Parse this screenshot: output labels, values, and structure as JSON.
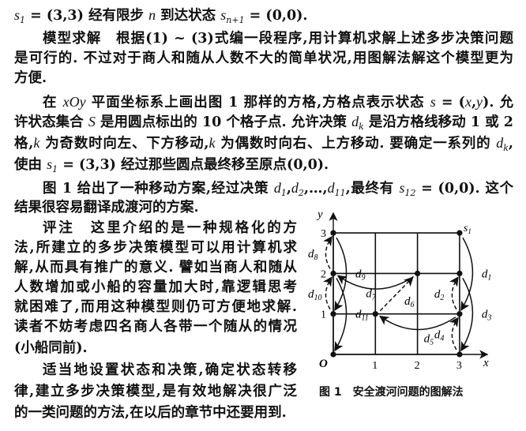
{
  "text": {
    "lines": [
      {
        "full": false,
        "indent": false,
        "segs": [
          [
            "m",
            "s"
          ],
          [
            "s",
            "1"
          ],
          [
            "t",
            " = (3,3) 经有限步 "
          ],
          [
            "m",
            "n"
          ],
          [
            "t",
            " 到达状态 "
          ],
          [
            "m",
            "s"
          ],
          [
            "s",
            "n+1"
          ],
          [
            "t",
            " = (0,0)."
          ]
        ]
      },
      {
        "full": true,
        "indent": true,
        "segs": [
          [
            "b",
            "模型求解"
          ],
          [
            "t",
            "　根据(1) ~ (3)式编一段程序,用计算机求解上述多步决策问题"
          ]
        ]
      },
      {
        "full": true,
        "indent": false,
        "segs": [
          [
            "t",
            "是可行的. 不过对于商人和随从人数不大的简单状况,用图解法解这个模型更为"
          ]
        ]
      },
      {
        "full": false,
        "indent": false,
        "segs": [
          [
            "t",
            "方便."
          ]
        ]
      },
      {
        "full": true,
        "indent": true,
        "segs": [
          [
            "t",
            "在 "
          ],
          [
            "m",
            "xOy"
          ],
          [
            "t",
            " 平面坐标系上画出图 1 那样的方格,方格点表示状态 "
          ],
          [
            "m",
            "s"
          ],
          [
            "t",
            " = ("
          ],
          [
            "m",
            "x"
          ],
          [
            "t",
            ","
          ],
          [
            "m",
            "y"
          ],
          [
            "t",
            "). 允"
          ]
        ]
      },
      {
        "full": true,
        "indent": false,
        "segs": [
          [
            "t",
            "许状态集合 "
          ],
          [
            "m",
            "S"
          ],
          [
            "t",
            " 是用圆点标出的 10 个格子点. 允许决策 "
          ],
          [
            "m",
            "d"
          ],
          [
            "s",
            "k"
          ],
          [
            "t",
            " 是沿方格线移动 1 或 2"
          ]
        ]
      },
      {
        "full": true,
        "indent": false,
        "segs": [
          [
            "t",
            "格,"
          ],
          [
            "m",
            "k"
          ],
          [
            "t",
            " 为奇数时向左、下方移动,"
          ],
          [
            "m",
            "k"
          ],
          [
            "t",
            " 为偶数时向右、上方移动. 要确定一系列的 "
          ],
          [
            "m",
            "d"
          ],
          [
            "s",
            "k"
          ],
          [
            "t",
            ","
          ]
        ]
      },
      {
        "full": false,
        "indent": false,
        "segs": [
          [
            "t",
            "使由 "
          ],
          [
            "m",
            "s"
          ],
          [
            "s",
            "1"
          ],
          [
            "t",
            " = (3,3) 经过那些圆点最终移至原点(0,0)."
          ]
        ]
      },
      {
        "full": true,
        "indent": true,
        "segs": [
          [
            "t",
            "图 1 给出了一种移动方案,经过决策 "
          ],
          [
            "m",
            "d"
          ],
          [
            "s",
            "1"
          ],
          [
            "t",
            ","
          ],
          [
            "m",
            "d"
          ],
          [
            "s",
            "2"
          ],
          [
            "t",
            ",…,"
          ],
          [
            "m",
            "d"
          ],
          [
            "s",
            "11"
          ],
          [
            "t",
            ",最终有 "
          ],
          [
            "m",
            "s"
          ],
          [
            "s",
            "12"
          ],
          [
            "t",
            " = (0,0). 这个"
          ]
        ]
      },
      {
        "full": false,
        "indent": false,
        "segs": [
          [
            "t",
            "结果很容易翻译成渡河的方案."
          ]
        ]
      },
      {
        "full": true,
        "indent": true,
        "narrow": true,
        "segs": [
          [
            "b",
            "评注"
          ],
          [
            "t",
            "　这里介绍的是一种规格化的方"
          ]
        ]
      },
      {
        "full": true,
        "indent": false,
        "narrow": true,
        "segs": [
          [
            "t",
            "法,所建立的多步决策模型可以用计算机求"
          ]
        ]
      },
      {
        "full": true,
        "indent": false,
        "narrow": true,
        "segs": [
          [
            "t",
            "解,从而具有推广的意义. 譬如当商人和随从"
          ]
        ]
      },
      {
        "full": true,
        "indent": false,
        "narrow": true,
        "segs": [
          [
            "t",
            "人数增加或小船的容量加大时,靠逻辑思考"
          ]
        ]
      },
      {
        "full": true,
        "indent": false,
        "narrow": true,
        "segs": [
          [
            "t",
            "就困难了,而用这种模型则仍可方便地求解."
          ]
        ]
      },
      {
        "full": true,
        "indent": false,
        "narrow": true,
        "segs": [
          [
            "t",
            "读者不妨考虑四名商人各带一个随从的情况"
          ]
        ]
      },
      {
        "full": false,
        "indent": false,
        "narrow": true,
        "segs": [
          [
            "t",
            "(小船同前)."
          ]
        ]
      },
      {
        "full": true,
        "indent": true,
        "narrow": true,
        "segs": [
          [
            "t",
            "适当地设置状态和决策,确定状态转移"
          ]
        ]
      },
      {
        "full": true,
        "indent": false,
        "narrow": true,
        "segs": [
          [
            "t",
            "律,建立多步决策模型,是有效地解决很广泛"
          ]
        ]
      },
      {
        "full": false,
        "indent": false,
        "narrow": true,
        "segs": [
          [
            "t",
            "的一类问题的方法,在以后的章节中还要用到."
          ]
        ]
      }
    ]
  },
  "figure": {
    "caption": "图 1　安全渡河问题的图解法",
    "x_axis_label": "x",
    "y_axis_label": "y",
    "origin_label": "O",
    "x_ticks": [
      "1",
      "2",
      "3"
    ],
    "y_ticks": [
      "1",
      "2",
      "3"
    ],
    "start_label": "s",
    "start_label_sub": "1",
    "grid_range": [
      0,
      3
    ],
    "points": [
      [
        3,
        3
      ],
      [
        3,
        2
      ],
      [
        3,
        1
      ],
      [
        3,
        0
      ],
      [
        2,
        2
      ],
      [
        1,
        1
      ],
      [
        0,
        3
      ],
      [
        0,
        2
      ],
      [
        0,
        1
      ],
      [
        0,
        0
      ]
    ],
    "moves": [
      {
        "label": "d",
        "sub": "1",
        "from": [
          3,
          3
        ],
        "to": [
          3,
          1
        ],
        "style": "solid"
      },
      {
        "label": "d",
        "sub": "2",
        "from": [
          3,
          1
        ],
        "to": [
          3,
          2
        ],
        "style": "dashed"
      },
      {
        "label": "d",
        "sub": "3",
        "from": [
          3,
          2
        ],
        "to": [
          3,
          0
        ],
        "style": "solid"
      },
      {
        "label": "d",
        "sub": "4",
        "from": [
          3,
          0
        ],
        "to": [
          3,
          1
        ],
        "style": "dashed"
      },
      {
        "label": "d",
        "sub": "5",
        "from": [
          3,
          1
        ],
        "to": [
          1,
          1
        ],
        "style": "solid"
      },
      {
        "label": "d",
        "sub": "6",
        "from": [
          1,
          1
        ],
        "to": [
          2,
          2
        ],
        "style": "dashed"
      },
      {
        "label": "d",
        "sub": "7",
        "from": [
          2,
          2
        ],
        "to": [
          0,
          2
        ],
        "style": "solid"
      },
      {
        "label": "d",
        "sub": "8",
        "from": [
          0,
          2
        ],
        "to": [
          0,
          3
        ],
        "style": "dashed"
      },
      {
        "label": "d",
        "sub": "9",
        "from": [
          0,
          3
        ],
        "to": [
          0,
          1
        ],
        "style": "solid"
      },
      {
        "label": "d",
        "sub": "10",
        "from": [
          0,
          1
        ],
        "to": [
          0,
          2
        ],
        "style": "dashed"
      },
      {
        "label": "d",
        "sub": "11",
        "from": [
          0,
          2
        ],
        "to": [
          0,
          0
        ],
        "style": "solid"
      }
    ]
  }
}
